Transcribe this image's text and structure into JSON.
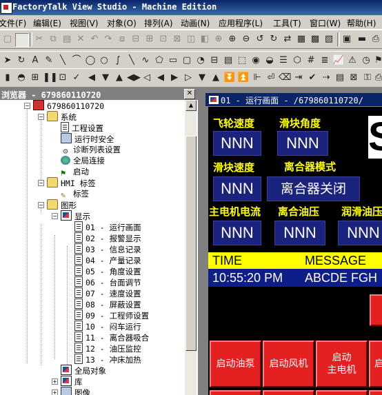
{
  "window": {
    "title": "FactoryTalk View Studio - Machine Edition"
  },
  "menus": [
    "文件(F)",
    "编辑(E)",
    "视图(V)",
    "对象(O)",
    "排列(A)",
    "动画(N)",
    "应用程序(L)",
    "工具(T)",
    "窗口(W)",
    "帮助(H)"
  ],
  "explorer": {
    "title": "浏览器 - 679860110720",
    "close_glyph": "✕",
    "tree": {
      "root": "679860110720",
      "system": "系统",
      "system_items": [
        "工程设置",
        "运行时安全",
        "诊断列表设置",
        "全局连接",
        "启动"
      ],
      "hmi_tags": "HMI 标签",
      "tags": "标签",
      "graphics": "图形",
      "displays": "显示",
      "display_items": [
        "01 - 运行画面",
        "02 - 报警显示",
        "03 - 信息记录",
        "04 - 产量记录",
        "05 - 角度设置",
        "06 - 台面调节",
        "07 - 速度设置",
        "08 - 屏蔽设置",
        "09 - 工程师设置",
        "10 - 闷车运行",
        "11 - 离合器吸合",
        "12 - 油压监控",
        "13 - 冲床加热"
      ],
      "global_objects": "全局对象",
      "library": "库",
      "images": "图像"
    }
  },
  "display": {
    "title": "01 - 运行画面 - /679860110720/",
    "big_glyph": "S",
    "labels": {
      "flywheel_speed": "飞轮速度",
      "slider_angle": "滑块角度",
      "slider_speed": "滑块速度",
      "clutch_mode": "离合器模式",
      "motor_current": "主电机电流",
      "clutch_oil": "离合油压",
      "lube_oil": "润滑油压"
    },
    "values": {
      "flywheel_speed": "NNN",
      "slider_angle": "NNN",
      "slider_speed": "NNN",
      "clutch_mode": "离合器关闭",
      "motor_current": "NNN",
      "clutch_oil": "NNN",
      "lube_oil": "NNN"
    },
    "alarm": {
      "time_header": "TIME",
      "message_header": "MESSAGE",
      "row_time": "10:55:20 PM",
      "row_message": "ABCDE FGH"
    },
    "buttons": {
      "start_pump": "启动油泵",
      "start_fan": "启动风机",
      "start_motor": "启动\n主电机",
      "partial": "启"
    },
    "colors": {
      "label": "#ffff00",
      "value_box": "#1a237e",
      "button": "#e52020",
      "alarm_header": "#ffff00",
      "alarm_row": "#0d1d8a"
    }
  }
}
